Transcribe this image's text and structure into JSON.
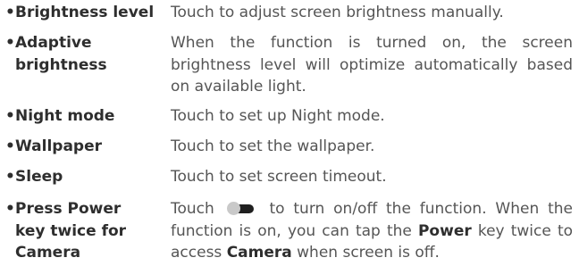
{
  "bullet": "•",
  "items": [
    {
      "term": "Brightness level",
      "description": "Touch to adjust screen brightness manually."
    },
    {
      "term": "Adaptive brightness",
      "description": "When the function is turned on, the screen brightness level will optimize automatically based on available light."
    },
    {
      "term": "Night mode",
      "description": "Touch to set up Night mode."
    },
    {
      "term": "Wallpaper",
      "description": "Touch to set the wallpaper."
    },
    {
      "term": "Sleep",
      "description": "Touch to set screen timeout."
    },
    {
      "term": "Press Power key twice for Camera",
      "description_parts": {
        "lead": "Touch",
        "toggle_icon": "toggle-switch-icon",
        "after_toggle": "to turn on/off the function. When the function is on, you can tap the",
        "bold_1": "Power",
        "middle": "key twice to access",
        "bold_2": "Camera",
        "tail": "when screen is off."
      }
    }
  ]
}
